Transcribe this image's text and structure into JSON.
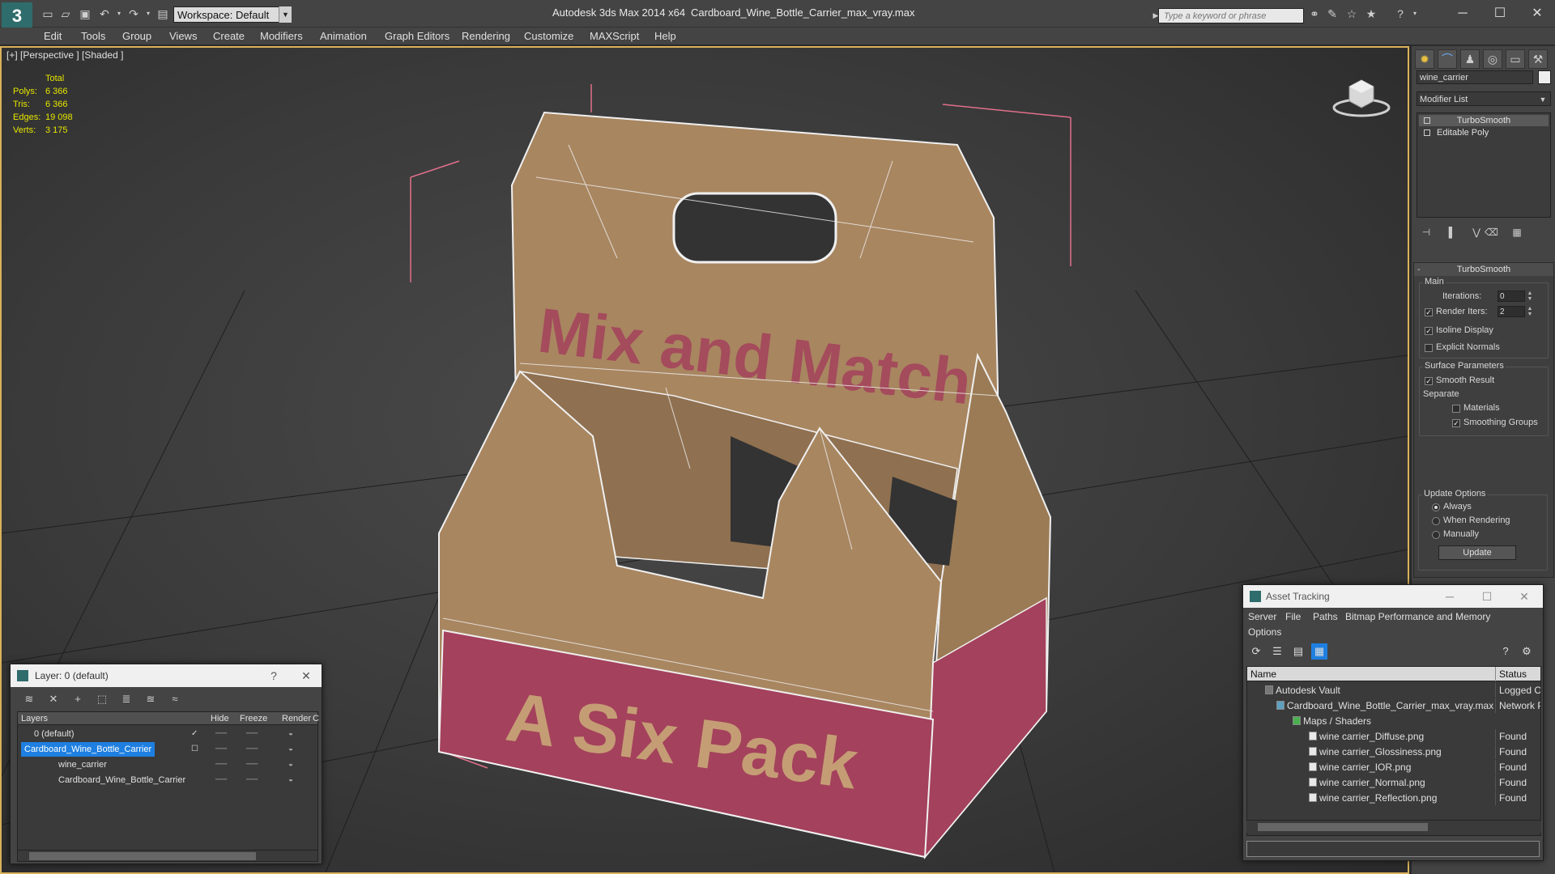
{
  "titlebar": {
    "logo": "3",
    "workspace": "Workspace: Default",
    "app_title": "Autodesk 3ds Max  2014 x64",
    "file_title": "Cardboard_Wine_Bottle_Carrier_max_vray.max",
    "search_placeholder": "Type a keyword or phrase",
    "minimize": "─",
    "maximize": "☐",
    "close": "✕"
  },
  "menu": [
    "Edit",
    "Tools",
    "Group",
    "Views",
    "Create",
    "Modifiers",
    "Animation",
    "Graph Editors",
    "Rendering",
    "Customize",
    "MAXScript",
    "Help"
  ],
  "viewport": {
    "label": "[+] [Perspective ] [Shaded ]",
    "stats": {
      "header": "Total",
      "rows": [
        {
          "label": "Polys:",
          "value": "6 366"
        },
        {
          "label": "Tris:",
          "value": "6 366"
        },
        {
          "label": "Edges:",
          "value": "19 098"
        },
        {
          "label": "Verts:",
          "value": "3 175"
        }
      ]
    },
    "print_top": "Mix and Match",
    "print_bottom": "A Six Pack",
    "colors": {
      "cardboard": "#a88660",
      "pink": "#a4415c",
      "wire": "#f0f0f0",
      "bbox": "#e0708a"
    }
  },
  "command_panel": {
    "object_name": "wine_carrier",
    "modifier_list": "Modifier List",
    "stack": [
      "TurboSmooth",
      "Editable Poly"
    ],
    "rollout_title": "TurboSmooth",
    "main_group": "Main",
    "iterations_label": "Iterations:",
    "iterations_value": "0",
    "render_iters_label": "Render Iters:",
    "render_iters_value": "2",
    "isoline_display": "Isoline Display",
    "explicit_normals": "Explicit Normals",
    "surface_params": "Surface Parameters",
    "smooth_result": "Smooth Result",
    "separate": "Separate",
    "materials": "Materials",
    "smoothing_groups": "Smoothing Groups",
    "update_options": "Update Options",
    "always": "Always",
    "when_rendering": "When Rendering",
    "manually": "Manually",
    "update_button": "Update"
  },
  "layer_dialog": {
    "title": "Layer: 0 (default)",
    "help": "?",
    "close": "✕",
    "columns": [
      "Layers",
      "Hide",
      "Freeze",
      "Render",
      "C"
    ],
    "rows": [
      {
        "name": "0 (default)",
        "check": "✓"
      },
      {
        "name": "Cardboard_Wine_Bottle_Carrier",
        "check": "☐"
      },
      {
        "name": "wine_carrier",
        "check": ""
      },
      {
        "name": "Cardboard_Wine_Bottle_Carrier",
        "check": ""
      }
    ]
  },
  "asset_dialog": {
    "title": "Asset Tracking",
    "minimize": "─",
    "maximize": "☐",
    "close": "✕",
    "menu": [
      "Server",
      "File",
      "Paths",
      "Bitmap Performance and Memory",
      "Options"
    ],
    "columns": [
      "Name",
      "Status"
    ],
    "rows": [
      {
        "name": "Autodesk Vault",
        "status": "Logged Ou"
      },
      {
        "name": "Cardboard_Wine_Bottle_Carrier_max_vray.max",
        "status": "Network P"
      },
      {
        "name": "Maps / Shaders",
        "status": ""
      },
      {
        "name": "wine carrier_Diffuse.png",
        "status": "Found"
      },
      {
        "name": "wine carrier_Glossiness.png",
        "status": "Found"
      },
      {
        "name": "wine carrier_IOR.png",
        "status": "Found"
      },
      {
        "name": "wine carrier_Normal.png",
        "status": "Found"
      },
      {
        "name": "wine carrier_Reflection.png",
        "status": "Found"
      }
    ]
  }
}
